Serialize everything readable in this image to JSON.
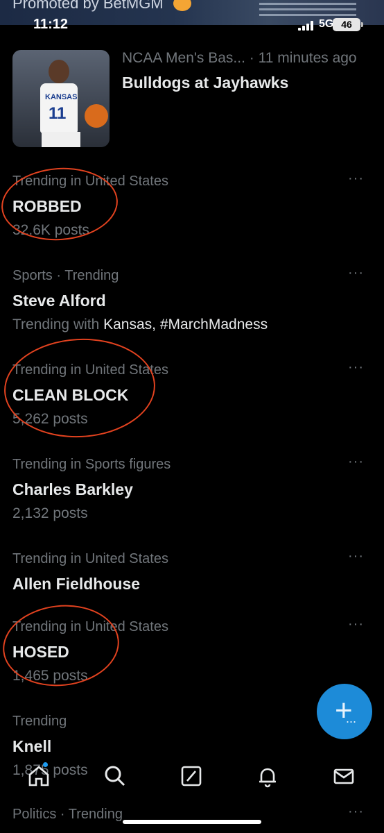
{
  "promo": {
    "text": "Promoted by BetMGM"
  },
  "status_bar": {
    "time": "11:12",
    "network": "5G",
    "battery": "46"
  },
  "news": {
    "category": "NCAA Men's Bas...",
    "time_ago": "· 11 minutes ago",
    "title": "Bulldogs at Jayhawks",
    "thumb_jersey_word": "KANSAS",
    "thumb_jersey_number": "11"
  },
  "trends": [
    {
      "context": "Trending in United States",
      "title": "ROBBED",
      "sub": "32.6K posts"
    },
    {
      "context": "Sports · Trending",
      "title": "Steve Alford",
      "sub_prefix": "Trending with ",
      "sub_highlight": "Kansas, #MarchMadness"
    },
    {
      "context": "Trending in United States",
      "title": "CLEAN BLOCK",
      "sub": "5,262 posts"
    },
    {
      "context": "Trending in Sports figures",
      "title": "Charles Barkley",
      "sub": "2,132 posts"
    },
    {
      "context": "Trending in United States",
      "title": "Allen Fieldhouse"
    },
    {
      "context": "Trending in United States",
      "title": "HOSED",
      "sub": "1,465 posts"
    },
    {
      "context": "Trending",
      "title": "Knell",
      "sub": "1,875 posts"
    }
  ],
  "peek_trend": {
    "context": "Politics · Trending"
  },
  "more_glyph": "···",
  "fab": {
    "plus": "+",
    "dots": "..."
  },
  "tabbar": {
    "icons": [
      "home-icon",
      "search-icon",
      "grok-icon",
      "notifications-icon",
      "messages-icon"
    ]
  },
  "colors": {
    "background": "#000000",
    "text": "#e7e9ea",
    "muted": "#71767b",
    "accent": "#1d9bf0",
    "annotation": "#e2421f"
  }
}
